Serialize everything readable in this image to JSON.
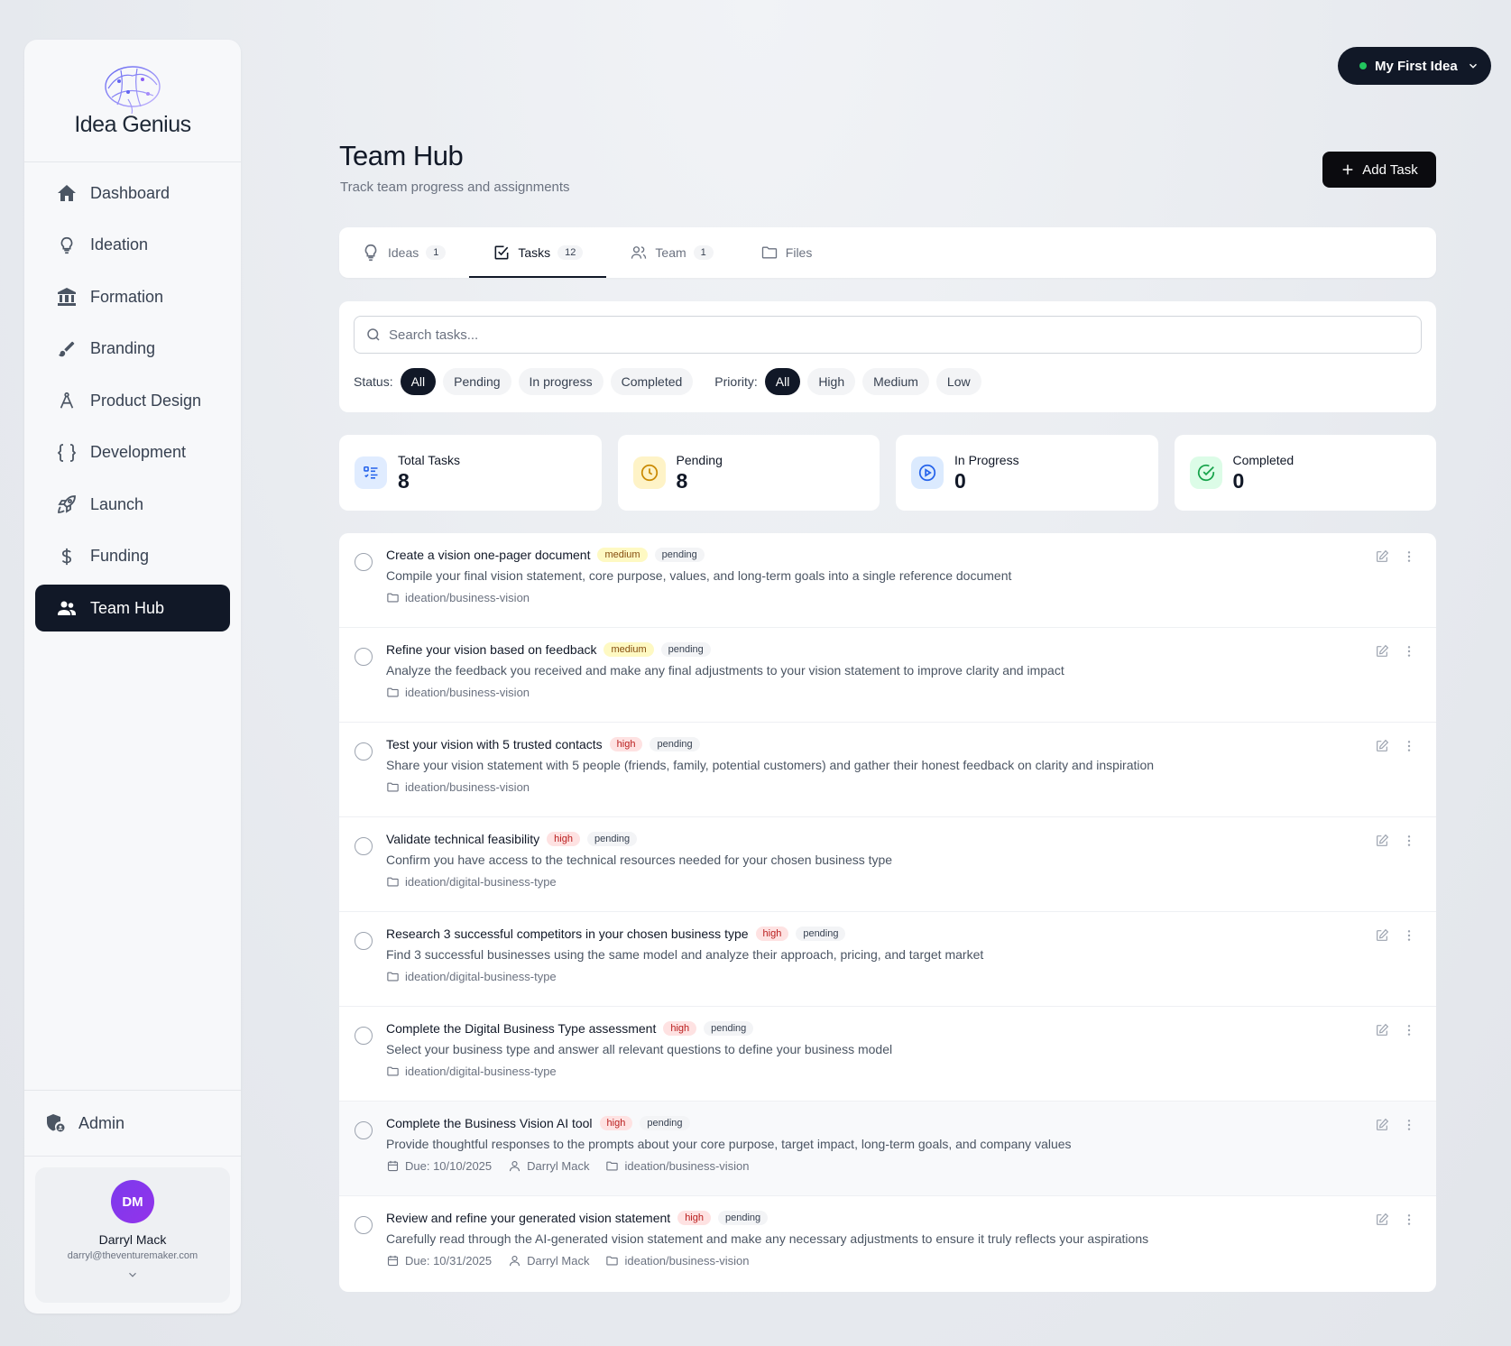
{
  "brand": {
    "name": "Idea Genius"
  },
  "sidebar": {
    "items": [
      {
        "label": "Dashboard",
        "icon": "home-icon"
      },
      {
        "label": "Ideation",
        "icon": "lightbulb-icon"
      },
      {
        "label": "Formation",
        "icon": "bank-icon"
      },
      {
        "label": "Branding",
        "icon": "brush-icon"
      },
      {
        "label": "Product Design",
        "icon": "compass-icon"
      },
      {
        "label": "Development",
        "icon": "code-braces-icon"
      },
      {
        "label": "Launch",
        "icon": "rocket-icon"
      },
      {
        "label": "Funding",
        "icon": "dollar-icon"
      },
      {
        "label": "Team Hub",
        "icon": "users-icon",
        "active": true
      }
    ],
    "admin_label": "Admin",
    "user": {
      "initials": "DM",
      "name": "Darryl Mack",
      "email": "darryl@theventuremaker.com"
    }
  },
  "idea_selector": {
    "label": "My First Idea",
    "status_color": "#22c55e"
  },
  "header": {
    "title": "Team Hub",
    "subtitle": "Track team progress and assignments",
    "add_task_label": "Add Task"
  },
  "tabs": [
    {
      "label": "Ideas",
      "count": "1",
      "icon": "lightbulb-icon"
    },
    {
      "label": "Tasks",
      "count": "12",
      "icon": "checkbox-icon",
      "active": true
    },
    {
      "label": "Team",
      "count": "1",
      "icon": "users-icon"
    },
    {
      "label": "Files",
      "count": "",
      "icon": "folder-icon"
    }
  ],
  "filters": {
    "search_placeholder": "Search tasks...",
    "status_label": "Status:",
    "status_options": [
      "All",
      "Pending",
      "In progress",
      "Completed"
    ],
    "priority_label": "Priority:",
    "priority_options": [
      "All",
      "High",
      "Medium",
      "Low"
    ]
  },
  "stats": [
    {
      "label": "Total Tasks",
      "value": "8",
      "icon": "list-icon",
      "bg": "#e0ecff",
      "color": "#2563eb"
    },
    {
      "label": "Pending",
      "value": "8",
      "icon": "clock-icon",
      "bg": "#fef3c7",
      "color": "#ca8a04"
    },
    {
      "label": "In Progress",
      "value": "0",
      "icon": "play-circle-icon",
      "bg": "#dbeafe",
      "color": "#2563eb"
    },
    {
      "label": "Completed",
      "value": "0",
      "icon": "check-circle-icon",
      "bg": "#dcfce7",
      "color": "#16a34a"
    }
  ],
  "tasks": [
    {
      "title": "Create a vision one-pager document",
      "priority": "medium",
      "status": "pending",
      "desc": "Compile your final vision statement, core purpose, values, and long-term goals into a single reference document",
      "due": "",
      "assignee": "",
      "path": "ideation/business-vision"
    },
    {
      "title": "Refine your vision based on feedback",
      "priority": "medium",
      "status": "pending",
      "desc": "Analyze the feedback you received and make any final adjustments to your vision statement to improve clarity and impact",
      "due": "",
      "assignee": "",
      "path": "ideation/business-vision"
    },
    {
      "title": "Test your vision with 5 trusted contacts",
      "priority": "high",
      "status": "pending",
      "desc": "Share your vision statement with 5 people (friends, family, potential customers) and gather their honest feedback on clarity and inspiration",
      "due": "",
      "assignee": "",
      "path": "ideation/business-vision"
    },
    {
      "title": "Validate technical feasibility",
      "priority": "high",
      "status": "pending",
      "desc": "Confirm you have access to the technical resources needed for your chosen business type",
      "due": "",
      "assignee": "",
      "path": "ideation/digital-business-type"
    },
    {
      "title": "Research 3 successful competitors in your chosen business type",
      "priority": "high",
      "status": "pending",
      "desc": "Find 3 successful businesses using the same model and analyze their approach, pricing, and target market",
      "due": "",
      "assignee": "",
      "path": "ideation/digital-business-type"
    },
    {
      "title": "Complete the Digital Business Type assessment",
      "priority": "high",
      "status": "pending",
      "desc": "Select your business type and answer all relevant questions to define your business model",
      "due": "",
      "assignee": "",
      "path": "ideation/digital-business-type"
    },
    {
      "title": "Complete the Business Vision AI tool",
      "priority": "high",
      "status": "pending",
      "desc": "Provide thoughtful responses to the prompts about your core purpose, target impact, long-term goals, and company values",
      "due": "Due: 10/10/2025",
      "assignee": "Darryl Mack",
      "path": "ideation/business-vision",
      "highlight": true
    },
    {
      "title": "Review and refine your generated vision statement",
      "priority": "high",
      "status": "pending",
      "desc": "Carefully read through the AI-generated vision statement and make any necessary adjustments to ensure it truly reflects your aspirations",
      "due": "Due: 10/31/2025",
      "assignee": "Darryl Mack",
      "path": "ideation/business-vision"
    }
  ]
}
